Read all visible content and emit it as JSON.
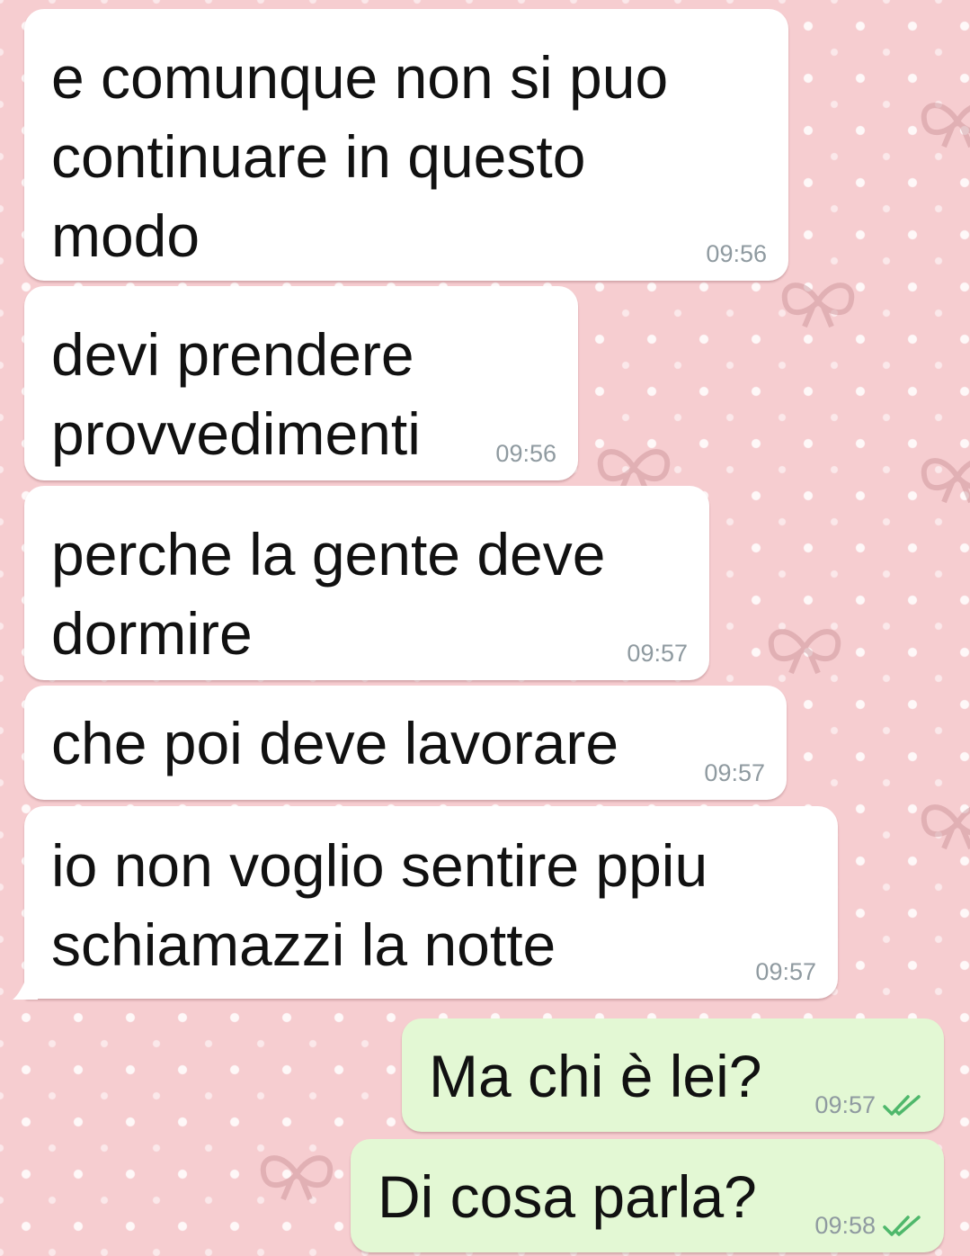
{
  "chat": {
    "colors": {
      "wallpaper": "#f6cdd0",
      "incoming_bubble": "#ffffff",
      "outgoing_bubble": "#e3f8d4",
      "timestamp": "#8f9aa0",
      "read_ticks": "#4fb86b"
    },
    "messages": [
      {
        "direction": "incoming",
        "lines": [
          "e comunque non si puo",
          "continuare in questo",
          "modo"
        ],
        "time": "09:56"
      },
      {
        "direction": "incoming",
        "lines": [
          "devi prendere",
          "provvedimenti"
        ],
        "time": "09:56"
      },
      {
        "direction": "incoming",
        "lines": [
          "perche la gente deve",
          "dormire"
        ],
        "time": "09:57"
      },
      {
        "direction": "incoming",
        "lines": [
          "che poi deve lavorare"
        ],
        "time": "09:57"
      },
      {
        "direction": "incoming",
        "lines": [
          "io non voglio sentire ppiu",
          "schiamazzi la notte"
        ],
        "time": "09:57"
      },
      {
        "direction": "outgoing",
        "lines": [
          "Ma chi è lei?"
        ],
        "time": "09:57",
        "status_icon": "double-check-read-icon"
      },
      {
        "direction": "outgoing",
        "lines": [
          "Di cosa parla?"
        ],
        "time": "09:58",
        "status_icon": "double-check-read-icon"
      }
    ]
  }
}
